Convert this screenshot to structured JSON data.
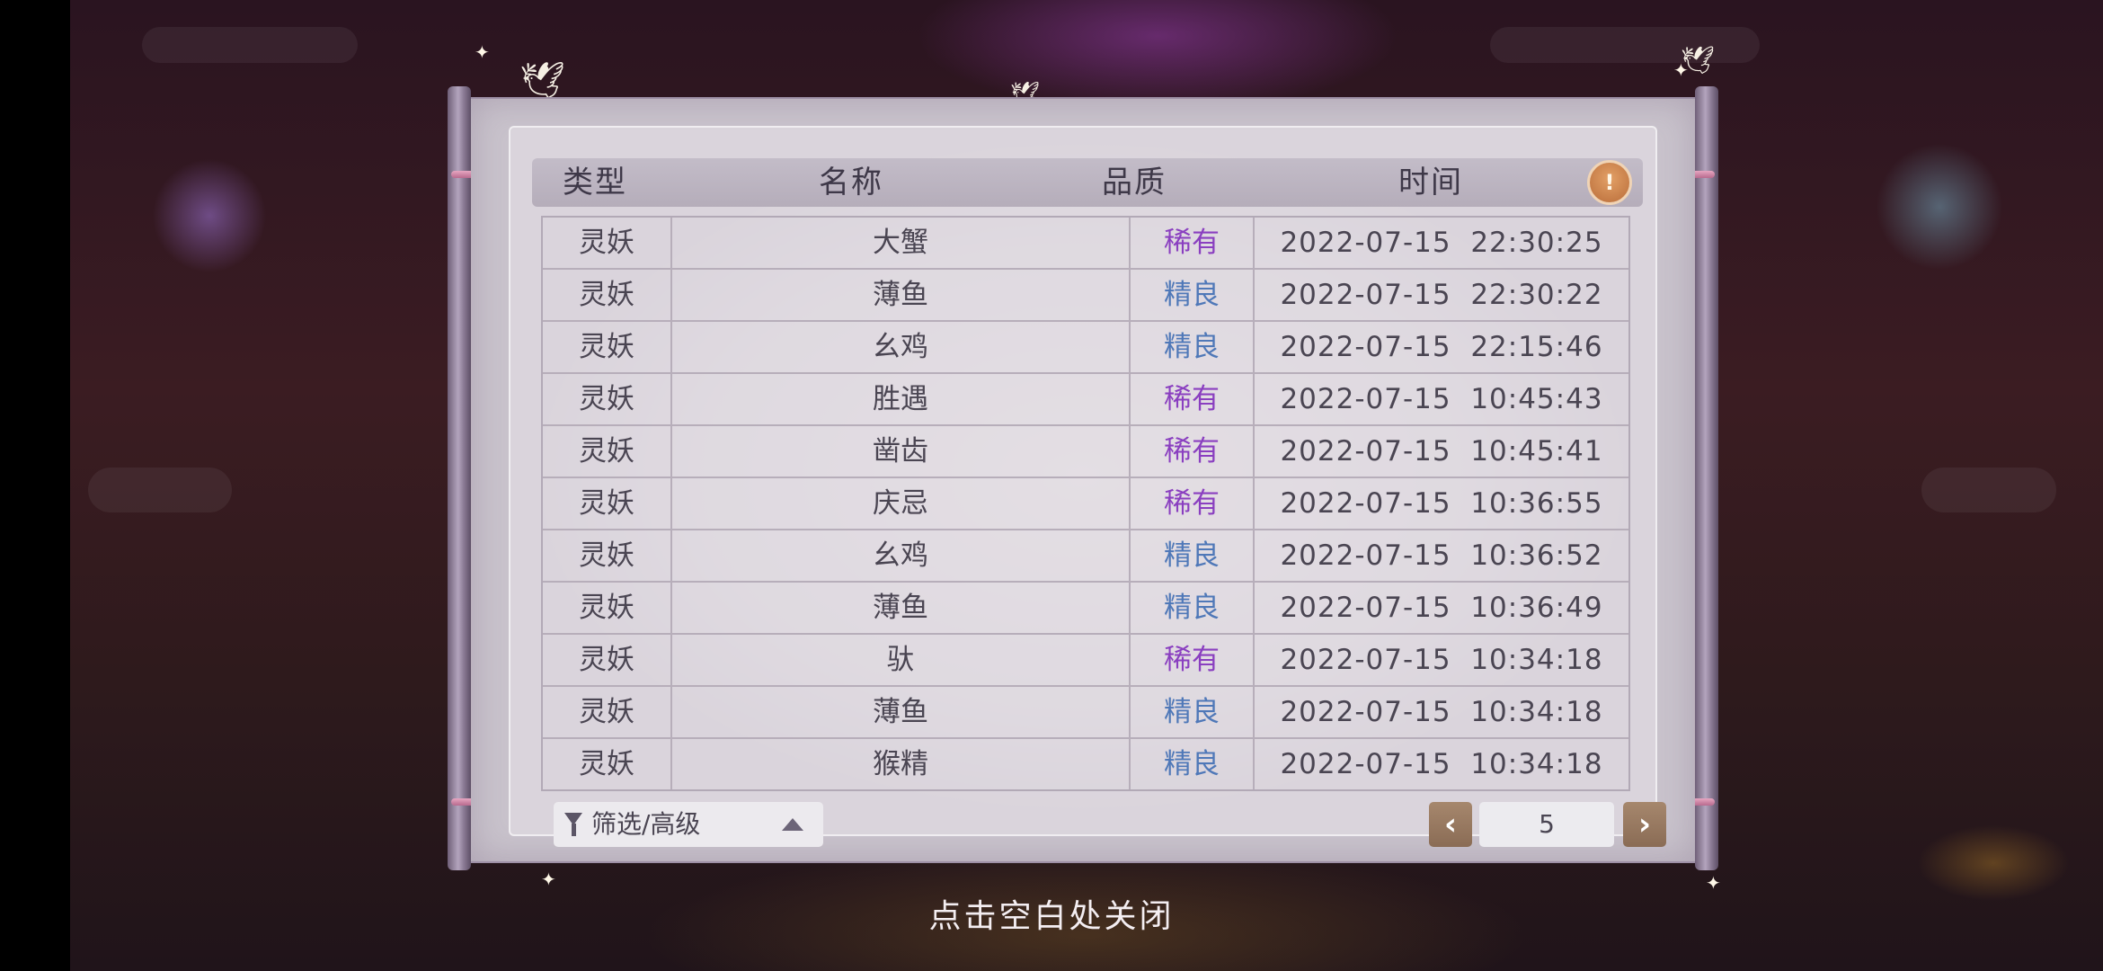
{
  "columns": {
    "type": "类型",
    "name": "名称",
    "quality": "品质",
    "time": "时间"
  },
  "rows": [
    {
      "type": "灵妖",
      "name": "大蟹",
      "quality": "稀有",
      "time": "2022-07-15  22:30:25"
    },
    {
      "type": "灵妖",
      "name": "薄鱼",
      "quality": "精良",
      "time": "2022-07-15  22:30:22"
    },
    {
      "type": "灵妖",
      "name": "幺鸡",
      "quality": "精良",
      "time": "2022-07-15  22:15:46"
    },
    {
      "type": "灵妖",
      "name": "胜遇",
      "quality": "稀有",
      "time": "2022-07-15  10:45:43"
    },
    {
      "type": "灵妖",
      "name": "凿齿",
      "quality": "稀有",
      "time": "2022-07-15  10:45:41"
    },
    {
      "type": "灵妖",
      "name": "庆忌",
      "quality": "稀有",
      "time": "2022-07-15  10:36:55"
    },
    {
      "type": "灵妖",
      "name": "幺鸡",
      "quality": "精良",
      "time": "2022-07-15  10:36:52"
    },
    {
      "type": "灵妖",
      "name": "薄鱼",
      "quality": "精良",
      "time": "2022-07-15  10:36:49"
    },
    {
      "type": "灵妖",
      "name": "驮",
      "quality": "稀有",
      "time": "2022-07-15  10:34:18"
    },
    {
      "type": "灵妖",
      "name": "薄鱼",
      "quality": "精良",
      "time": "2022-07-15  10:34:18"
    },
    {
      "type": "灵妖",
      "name": "猴精",
      "quality": "精良",
      "time": "2022-07-15  10:34:18"
    }
  ],
  "quality_colors": {
    "稀有": "#8a3fc0",
    "精良": "#4f78b8"
  },
  "filter": {
    "label": "筛选/高级",
    "icon": "filter-icon"
  },
  "pagination": {
    "current_page": "5",
    "prev_icon": "chevron-left-icon",
    "next_icon": "chevron-right-icon"
  },
  "info_icon": "lightbulb-icon",
  "close_hint": "点击空白处关闭"
}
